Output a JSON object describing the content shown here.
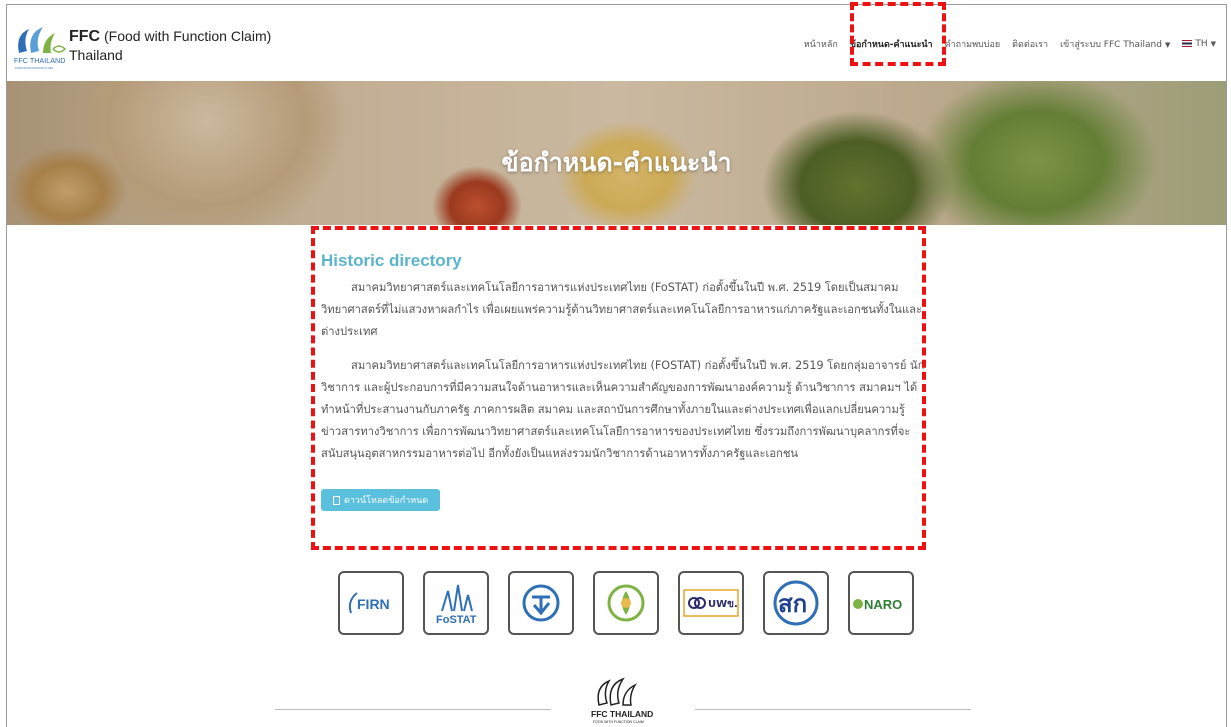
{
  "header": {
    "brand_bold": "FFC",
    "brand_rest": " (Food with Function Claim)",
    "brand_line2": "Thailand",
    "logo_text": "FFC THAILAND",
    "logo_subtext": "FOOD WITH FUNCTION CLAIM"
  },
  "nav": {
    "items": [
      {
        "label": "หน้าหลัก"
      },
      {
        "label": "ข้อกำหนด-คำแนะนำ",
        "active": true
      },
      {
        "label": "คำถามพบบ่อย"
      },
      {
        "label": "ติดต่อเรา"
      },
      {
        "label": "เข้าสู่ระบบ FFC Thailand"
      },
      {
        "label": "TH"
      }
    ]
  },
  "hero": {
    "title": "ข้อกำหนด-คำแนะนำ"
  },
  "content": {
    "section_title": "Historic directory",
    "paragraph1": "สมาคมวิทยาศาสตร์และเทคโนโลยีการอาหารแห่งประเทศไทย (FoSTAT) ก่อตั้งขึ้นในปี พ.ศ. 2519 โดยเป็นสมาคมวิทยาศาสตร์ที่ไม่แสวงหาผลกำไร เพื่อเผยแพร่ความรู้ด้านวิทยาศาสตร์และเทคโนโลยีการอาหารแก่ภาครัฐและเอกชนทั้งในและต่างประเทศ",
    "paragraph2": "สมาคมวิทยาศาสตร์และเทคโนโลยีการอาหารแห่งประเทศไทย (FOSTAT) ก่อตั้งขึ้นในปี พ.ศ. 2519 โดยกลุ่มอาจารย์ นักวิชาการ และผู้ประกอบการที่มีความสนใจด้านอาหารและเห็นความสำคัญของการพัฒนาองค์ความรู้ ด้านวิชาการ สมาคมฯ ได้ทำหน้าที่ประสานงานกับภาครัฐ ภาคการผลิต สมาคม และสถาบันการศึกษาทั้งภายในและต่างประเทศเพื่อแลกเปลี่ยนความรู้ข่าวสารทางวิชาการ เพื่อการพัฒนาวิทยาศาสตร์และเทคโนโลยีการอาหารของประเทศไทย ซึ่งรวมถึงการพัฒนาบุคลากรที่จะสนับสนุนอุตสาหกรรมอาหารต่อไป อีกทั้งยังเป็นแหล่งรวมนักวิชาการด้านอาหารทั้งภาครัฐและเอกชน",
    "download_button": "ดาวน์โหลดข้อกำหนด"
  },
  "partners": [
    {
      "name": "FIRN",
      "label": "FIRN",
      "icon": "firn-logo"
    },
    {
      "name": "FoSTAT",
      "label": "FoSTAT",
      "icon": "fostat-logo"
    },
    {
      "name": "Check mark agency",
      "label": "",
      "icon": "checkmark-logo"
    },
    {
      "name": "Green emblem",
      "label": "",
      "icon": "emblem-logo"
    },
    {
      "name": "UWB",
      "label": "UWข.",
      "icon": "uwb-logo"
    },
    {
      "name": "STK",
      "label": "สก",
      "icon": "stk-logo"
    },
    {
      "name": "NARO",
      "label": "NARO",
      "icon": "naro-logo"
    }
  ],
  "footer": {
    "logo_text": "FFC THAILAND",
    "logo_subtext": "FOOD WITH FUNCTION CLAIM"
  },
  "colors": {
    "accent": "#5bc0de",
    "title": "#5bb4cc",
    "highlight": "#ee1111",
    "logo_blue": "#2f6fb5",
    "logo_green": "#7cb342"
  }
}
